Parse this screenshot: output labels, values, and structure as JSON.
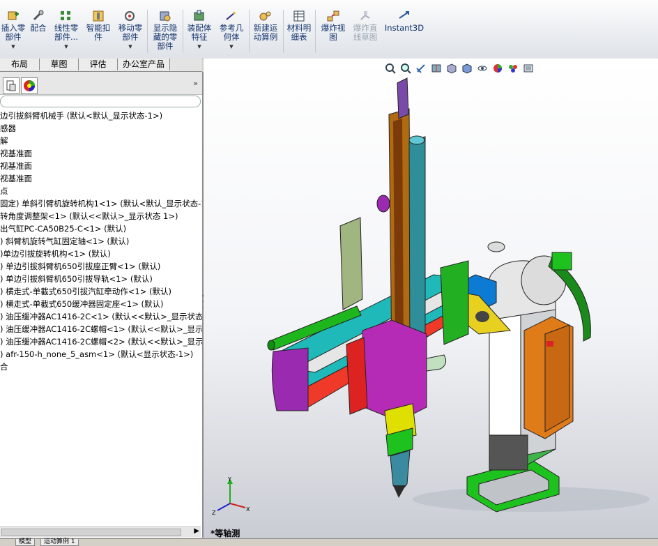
{
  "toolbar": {
    "buttons": [
      {
        "label": "插入零\n部件",
        "icon": "insert-component-icon"
      },
      {
        "label": "配合",
        "icon": "mate-icon"
      },
      {
        "label": "线性零\n部件...",
        "icon": "linear-pattern-icon"
      },
      {
        "label": "智能扣\n件",
        "icon": "smart-fasteners-icon"
      },
      {
        "label": "移动零\n部件",
        "icon": "move-component-icon"
      },
      {
        "label": "显示隐\n藏的零\n部件",
        "icon": "show-hidden-icon"
      },
      {
        "label": "装配体\n特征",
        "icon": "assembly-features-icon"
      },
      {
        "label": "参考几\n何体",
        "icon": "reference-geometry-icon"
      },
      {
        "label": "新建运\n动算例",
        "icon": "new-motion-study-icon"
      },
      {
        "label": "材料明\n细表",
        "icon": "bill-of-materials-icon"
      },
      {
        "label": "爆炸视\n图",
        "icon": "exploded-view-icon"
      },
      {
        "label": "爆炸直\n线草图",
        "icon": "explode-line-sketch-icon"
      },
      {
        "label": "Instant3D",
        "icon": "instant3d-icon"
      }
    ]
  },
  "command_tabs": [
    "布局",
    "草图",
    "评估",
    "办公室产品"
  ],
  "panel": {
    "expand_glyph": "»"
  },
  "tree": {
    "rows": [
      "边引拔斜臂机械手  (默认<默认_显示状态-1>)",
      "感器",
      "解",
      "视基准面",
      "视基准面",
      "视基准面",
      "点",
      "固定) 单斜引臂机旋转机构1<1> (默认<默认_显示状态-1",
      "转角度调整架<1> (默认<<默认>_显示状态 1>)",
      "出气缸PC-CA50B25-C<1> (默认)",
      ") 斜臂机旋转气缸固定轴<1> (默认)",
      ")单边引拔旋转机构<1> (默认)",
      ") 单边引拔斜臂机650引拔座正臂<1> (默认)",
      ") 单边引拔斜臂机650引拔导轨<1> (默认)",
      ") 横走式-单截式650引拔汽缸牵动作<1> (默认)",
      ") 横走式-单截式650缓冲器固定座<1> (默认)",
      ") 油压缓冲器AC1416-2C<1> (默认<<默认>_显示状态 1",
      ") 油压缓冲器AC1416-2C螺帽<1> (默认<<默认>_显示状",
      ") 油压缓冲器AC1416-2C螺帽<2> (默认<<默认>_显示状",
      ") afr-150-h_none_5_asm<1> (默认<显示状态-1>)",
      "合"
    ]
  },
  "viewport": {
    "view_name": "*等轴测",
    "tools": [
      "zoom-to-fit-icon",
      "zoom-area-icon",
      "previous-view-icon",
      "section-view-icon",
      "view-orientation-icon",
      "display-style-icon",
      "hide-show-icon",
      "appearance-icon",
      "scene-icon",
      "view-settings-icon"
    ],
    "triad": {
      "x": "X",
      "y": "Y",
      "z": "Z"
    }
  },
  "bottom_tabs": [
    "模型",
    "运动算例 1"
  ],
  "colors": {
    "accent": "#10306a",
    "background_top": "#ffffff",
    "background_bottom": "#c9ccd3"
  }
}
